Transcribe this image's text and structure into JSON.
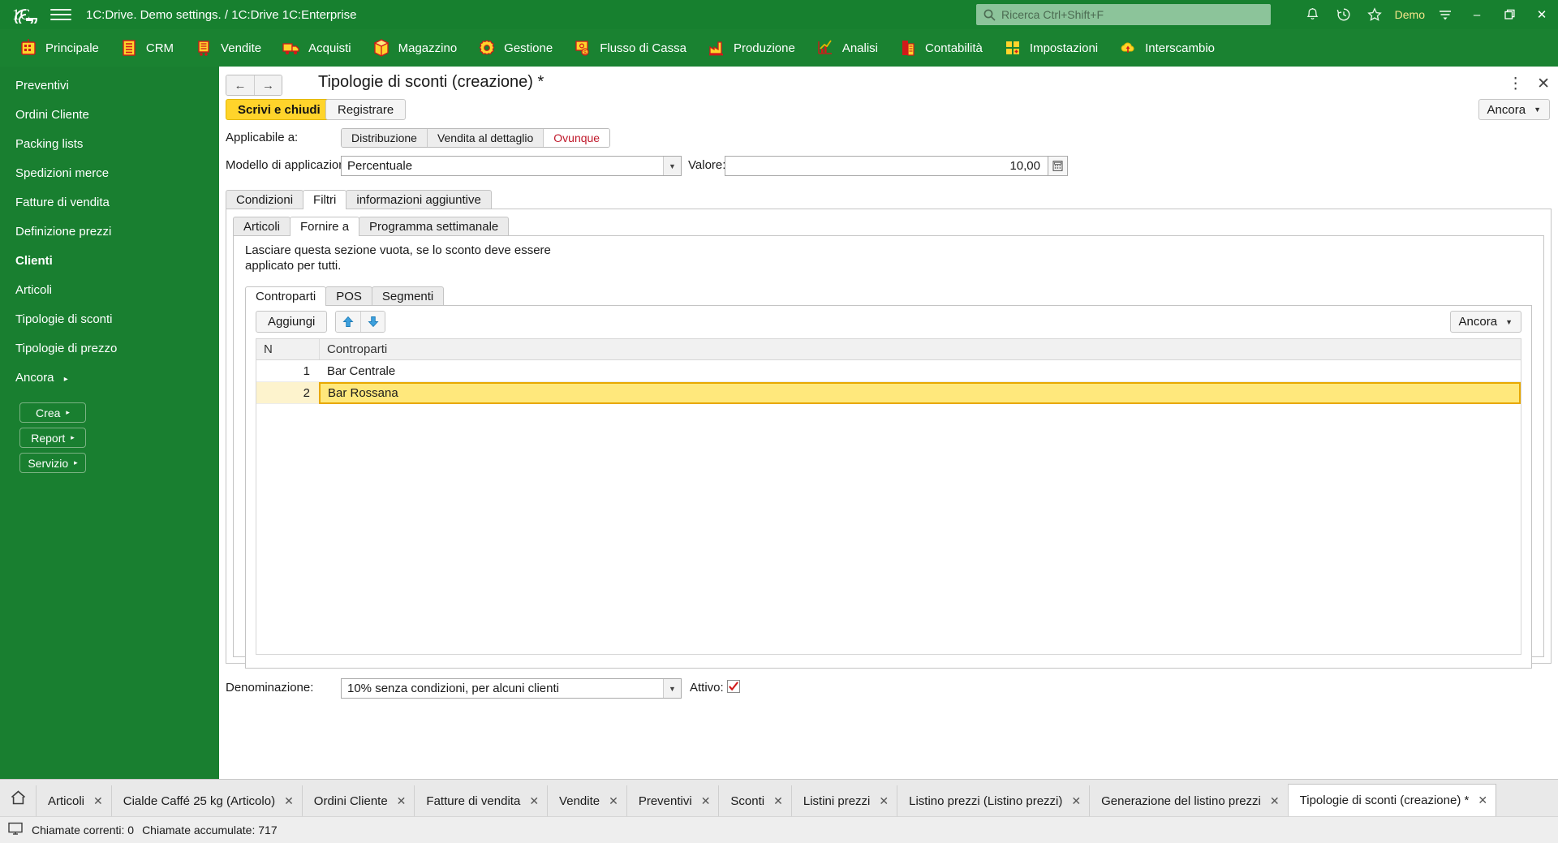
{
  "titlebar": {
    "logo_icon": "1c-logo-icon",
    "menu_icon": "hamburger-menu-icon",
    "app_title": "1C:Drive. Demo settings. / 1C:Drive 1C:Enterprise",
    "search_placeholder": "Ricerca Ctrl+Shift+F",
    "search_icon": "search-icon",
    "notifications_icon": "bell-icon",
    "history_icon": "history-clock-icon",
    "favorites_icon": "star-icon",
    "user": "Demo",
    "main_menu_icon": "lines-menu-icon",
    "minimize": "–",
    "maximize": "❐",
    "close": "✕"
  },
  "nav": {
    "items": [
      {
        "label": "Principale",
        "icon": "home-panel-icon"
      },
      {
        "label": "CRM",
        "icon": "crm-icon"
      },
      {
        "label": "Vendite",
        "icon": "sales-cart-icon"
      },
      {
        "label": "Acquisti",
        "icon": "purchases-truck-icon"
      },
      {
        "label": "Magazzino",
        "icon": "warehouse-box-icon"
      },
      {
        "label": "Gestione",
        "icon": "management-gear-icon"
      },
      {
        "label": "Flusso di Cassa",
        "icon": "cashflow-icon"
      },
      {
        "label": "Produzione",
        "icon": "production-factory-icon"
      },
      {
        "label": "Analisi",
        "icon": "analysis-chart-icon"
      },
      {
        "label": "Contabilità",
        "icon": "accounting-icon"
      },
      {
        "label": "Impostazioni",
        "icon": "settings-squares-icon"
      },
      {
        "label": "Interscambio",
        "icon": "exchange-cloud-icon"
      }
    ]
  },
  "sidebar": {
    "items": [
      {
        "label": "Preventivi",
        "bold": false
      },
      {
        "label": "Ordini Cliente",
        "bold": false
      },
      {
        "label": "Packing lists",
        "bold": false
      },
      {
        "label": "Spedizioni merce",
        "bold": false
      },
      {
        "label": "Fatture di vendita",
        "bold": false
      },
      {
        "label": "Definizione prezzi",
        "bold": false
      },
      {
        "label": "Clienti",
        "bold": true
      },
      {
        "label": "Articoli",
        "bold": false
      },
      {
        "label": "Tipologie di sconti",
        "bold": false
      },
      {
        "label": "Tipologie di prezzo",
        "bold": false
      }
    ],
    "more_label": "Ancora",
    "buttons": [
      {
        "label": "Crea"
      },
      {
        "label": "Report"
      },
      {
        "label": "Servizio"
      }
    ]
  },
  "form": {
    "back_icon": "arrow-left-icon",
    "forward_icon": "arrow-right-icon",
    "title": "Tipologie di sconti (creazione) *",
    "more_menu_icon": "kebab-menu-icon",
    "close_icon": "close-icon",
    "commands": {
      "save_and_close": "Scrivi e chiudi",
      "register": "Registrare",
      "more": "Ancora"
    },
    "applicable": {
      "label": "Applicabile a:",
      "options": [
        "Distribuzione",
        "Vendita al dettaglio",
        "Ovunque"
      ],
      "selected": "Ovunque"
    },
    "model": {
      "label": "Modello di applicazione:",
      "value": "Percentuale"
    },
    "value": {
      "label": "Valore:",
      "value": "10,00",
      "calc_icon": "calculator-icon"
    },
    "tabs": {
      "items": [
        "Condizioni",
        "Filtri",
        "informazioni aggiuntive"
      ],
      "active": "Filtri"
    },
    "subtabs": {
      "items": [
        "Articoli",
        "Fornire a",
        "Programma settimanale"
      ],
      "active": "Fornire a"
    },
    "hint": "Lasciare questa sezione vuota, se lo sconto deve essere applicato per tutti.",
    "innertabs": {
      "items": [
        "Controparti",
        "POS",
        "Segmenti"
      ],
      "active": "Controparti"
    },
    "grid_toolbar": {
      "add": "Aggiungi",
      "move_up_icon": "arrow-up-icon",
      "move_down_icon": "arrow-down-icon",
      "more": "Ancora"
    },
    "grid": {
      "columns": [
        "N",
        "Controparti"
      ],
      "rows": [
        {
          "n": "1",
          "value": "Bar Centrale",
          "selected": false
        },
        {
          "n": "2",
          "value": "Bar Rossana",
          "selected": true
        }
      ]
    },
    "footer": {
      "name_label": "Denominazione:",
      "name_value": "10% senza condizioni, per alcuni clienti",
      "active_label": "Attivo:",
      "active_checked": true
    }
  },
  "taskbar": {
    "home_icon": "home-icon",
    "tabs": [
      {
        "label": "Articoli",
        "active": false
      },
      {
        "label": "Cialde Caffé 25 kg (Articolo)",
        "active": false
      },
      {
        "label": "Ordini Cliente",
        "active": false
      },
      {
        "label": "Fatture di vendita",
        "active": false
      },
      {
        "label": "Vendite",
        "active": false
      },
      {
        "label": "Preventivi",
        "active": false
      },
      {
        "label": "Sconti",
        "active": false
      },
      {
        "label": "Listini prezzi",
        "active": false
      },
      {
        "label": "Listino prezzi (Listino prezzi)",
        "active": false
      },
      {
        "label": "Generazione del listino prezzi",
        "active": false
      },
      {
        "label": "Tipologie di sconti (creazione) *",
        "active": true
      }
    ]
  },
  "statusbar": {
    "icon": "monitor-icon",
    "current_calls": "Chiamate correnti: 0",
    "accumulated_calls": "Chiamate accumulate: 717"
  },
  "colors": {
    "brand_green": "#17802f",
    "accent_yellow": "#ffd42b",
    "selection_yellow": "#ffe87c",
    "danger_red": "#c0192b"
  }
}
